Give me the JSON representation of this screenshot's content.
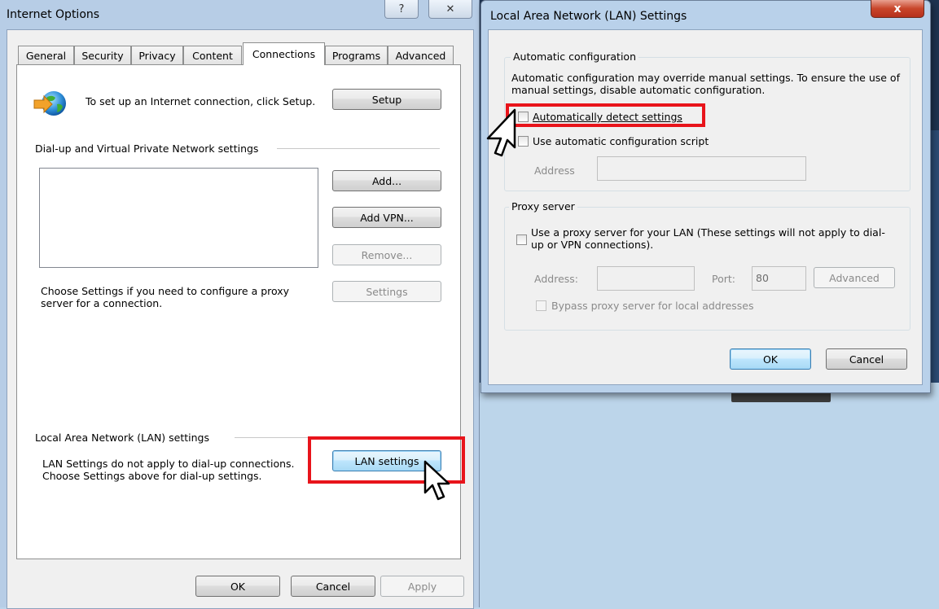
{
  "internet_options": {
    "title": "Internet Options",
    "title_buttons": [
      "?",
      "✕"
    ],
    "tabs": [
      "General",
      "Security",
      "Privacy",
      "Content",
      "Connections",
      "Programs",
      "Advanced"
    ],
    "active_tab": "Connections",
    "setup_text": "To set up an Internet connection, click Setup.",
    "setup_button": "Setup",
    "dialup_group": "Dial-up and Virtual Private Network settings",
    "add_button": "Add...",
    "add_vpn_button": "Add VPN...",
    "remove_button": "Remove...",
    "settings_text": "Choose Settings if you need to configure a proxy server for a connection.",
    "settings_button": "Settings",
    "lan_group": "Local Area Network (LAN) settings",
    "lan_text": "LAN Settings do not apply to dial-up connections. Choose Settings above for dial-up settings.",
    "lan_button": "LAN settings",
    "ok": "OK",
    "cancel": "Cancel",
    "apply": "Apply"
  },
  "lan_dialog": {
    "title": "Local Area Network (LAN) Settings",
    "close": "x",
    "auto_group": "Automatic configuration",
    "auto_desc": "Automatic configuration may override manual settings.  To ensure the use of manual settings, disable automatic configuration.",
    "auto_detect": "Automatically detect settings",
    "auto_detect_checked": false,
    "auto_script": "Use automatic configuration script",
    "auto_script_checked": false,
    "address_label": "Address",
    "address_value": "",
    "proxy_group": "Proxy server",
    "use_proxy": "Use a proxy server for your LAN (These settings will not apply to dial-up or VPN connections).",
    "use_proxy_checked": false,
    "proxy_address_label": "Address:",
    "proxy_address_value": "",
    "port_label": "Port:",
    "port_value": "80",
    "advanced_button": "Advanced",
    "bypass": "Bypass proxy server for local addresses",
    "bypass_checked": false,
    "ok": "OK",
    "cancel": "Cancel"
  },
  "annotations": {
    "highlight_color": "#e8141b"
  }
}
